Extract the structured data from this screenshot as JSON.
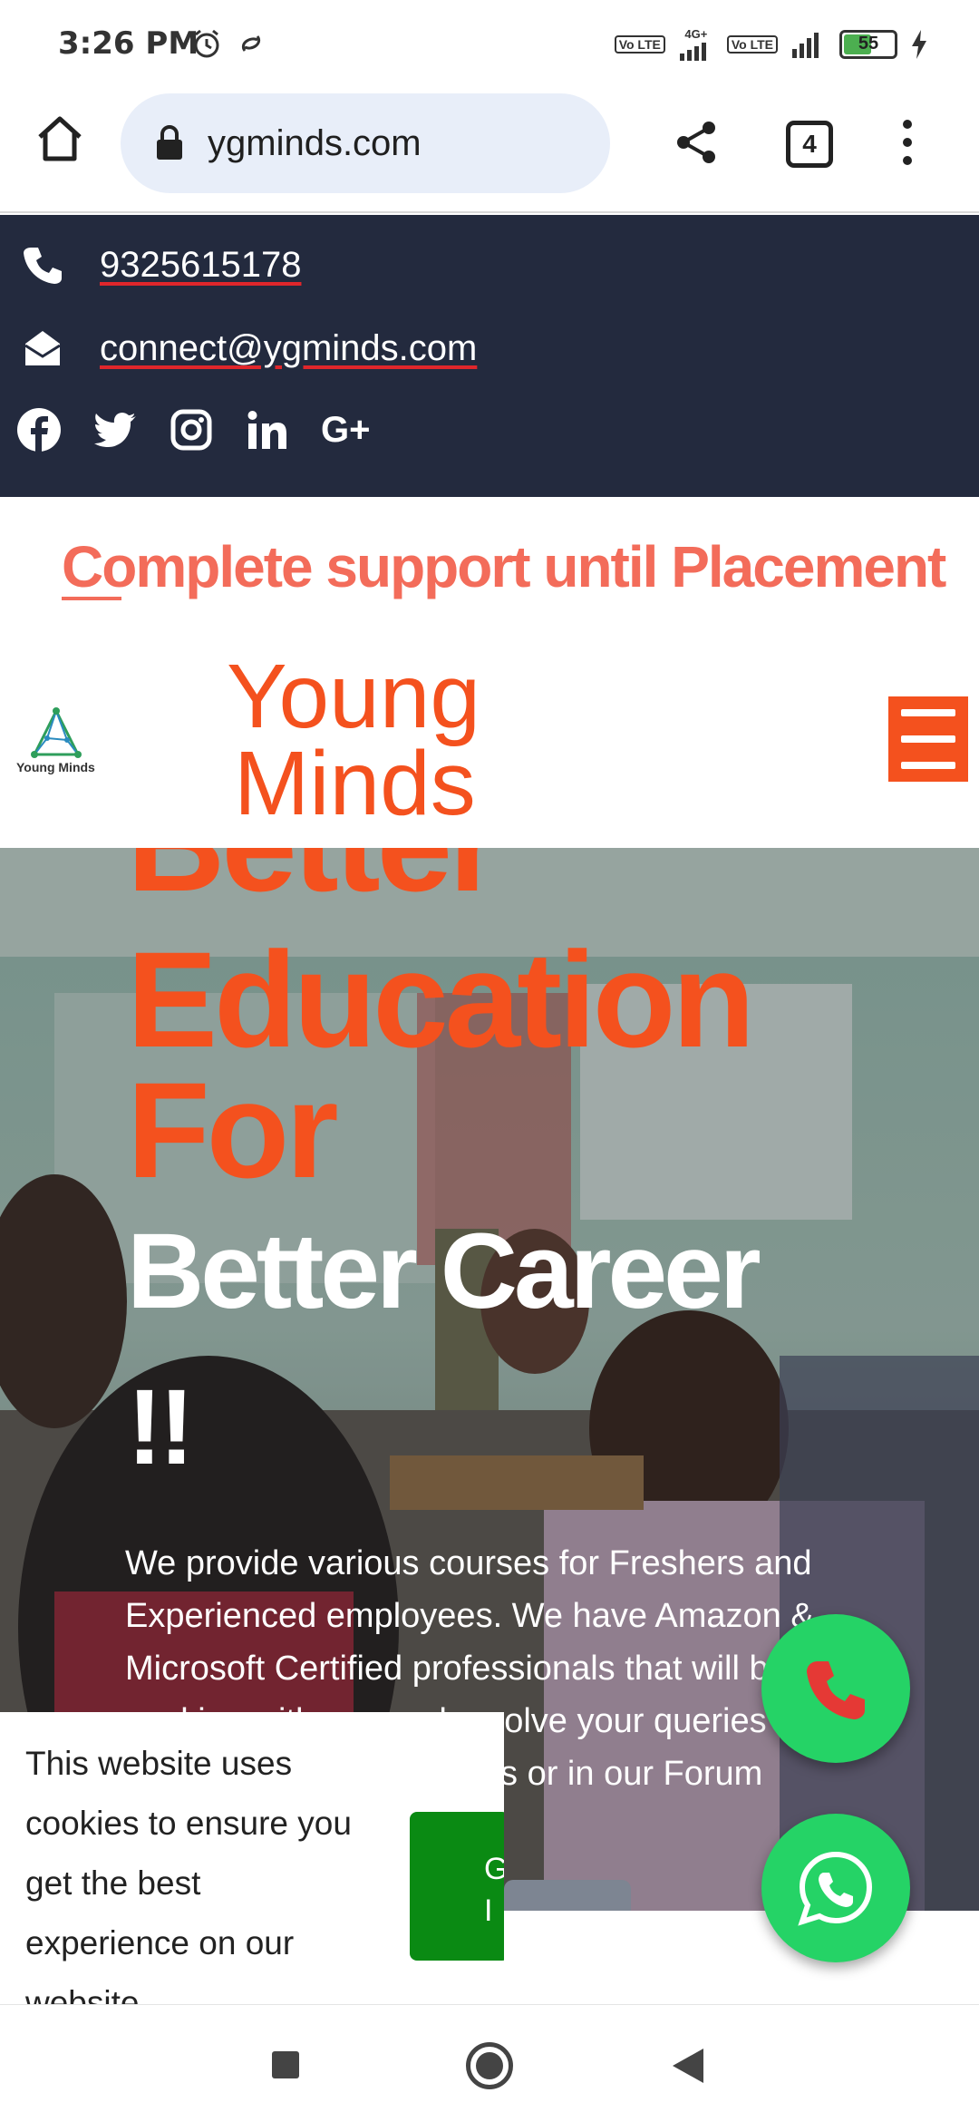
{
  "status_bar": {
    "time": "3:26 PM",
    "network_1": "Vo LTE",
    "network_label": "4G+",
    "network_2": "Vo LTE",
    "battery": "55",
    "icons": [
      "alarm-icon",
      "sync-icon",
      "signal-icon",
      "battery-icon",
      "charging-icon"
    ]
  },
  "browser": {
    "url": "ygminds.com",
    "tab_count": "4",
    "icons": [
      "home-icon",
      "lock-icon",
      "share-icon",
      "more-vert-icon"
    ]
  },
  "contact": {
    "phone": "9325615178",
    "email": "connect@ygminds.com",
    "social": [
      "facebook-icon",
      "twitter-icon",
      "instagram-icon",
      "linkedin-icon",
      "google-plus-icon"
    ],
    "gplus_text": "G+"
  },
  "banner": {
    "text": "Complete support until Placement"
  },
  "header": {
    "logo_caption": "Young Minds",
    "brand_line1": "Young",
    "brand_line2": "Minds"
  },
  "hero": {
    "line1": "Better",
    "line2": "Education",
    "line3": "For",
    "line4": "Better Career",
    "line5": "!!",
    "paragraph": "We provide various courses for Freshers and Experienced employees. We have Amazon & Microsoft Certified professionals that will be working with you and resolve your queries either during the sessions or in our Forum"
  },
  "cookie": {
    "text": "This website uses cookies to ensure you get the best experience on our website.",
    "button_line1": "G",
    "button_line2": "I"
  },
  "colors": {
    "accent": "#f4511e",
    "banner_text": "#f36c5a",
    "contact_band": "#232a3e",
    "fab": "#25d366",
    "cookie_button": "#0a8a13"
  }
}
